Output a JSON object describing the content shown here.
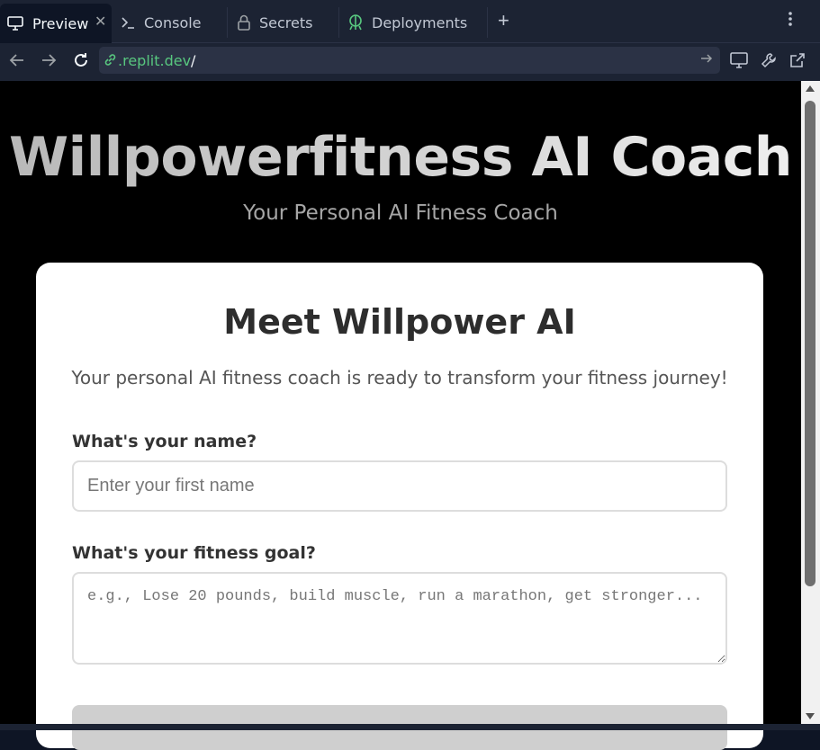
{
  "tabs": [
    {
      "label": "Preview",
      "icon": "monitor-icon",
      "active": true
    },
    {
      "label": "Console",
      "icon": "terminal-icon"
    },
    {
      "label": "Secrets",
      "icon": "lock-icon"
    },
    {
      "label": "Deployments",
      "icon": "deployments-icon"
    }
  ],
  "url": {
    "host": ".replit.dev",
    "path": "/"
  },
  "hero": {
    "title": "Willpowerfitness AI Coach",
    "subtitle": "Your Personal AI Fitness Coach"
  },
  "card": {
    "title": "Meet Willpower AI",
    "subtitle": "Your personal AI fitness coach is ready to transform your fitness journey!",
    "name_label": "What's your name?",
    "name_placeholder": "Enter your first name",
    "goal_label": "What's your fitness goal?",
    "goal_placeholder": "e.g., Lose 20 pounds, build muscle, run a marathon, get stronger..."
  },
  "colors": {
    "url_green": "#58c77f",
    "deploy_green": "#58c77f"
  }
}
